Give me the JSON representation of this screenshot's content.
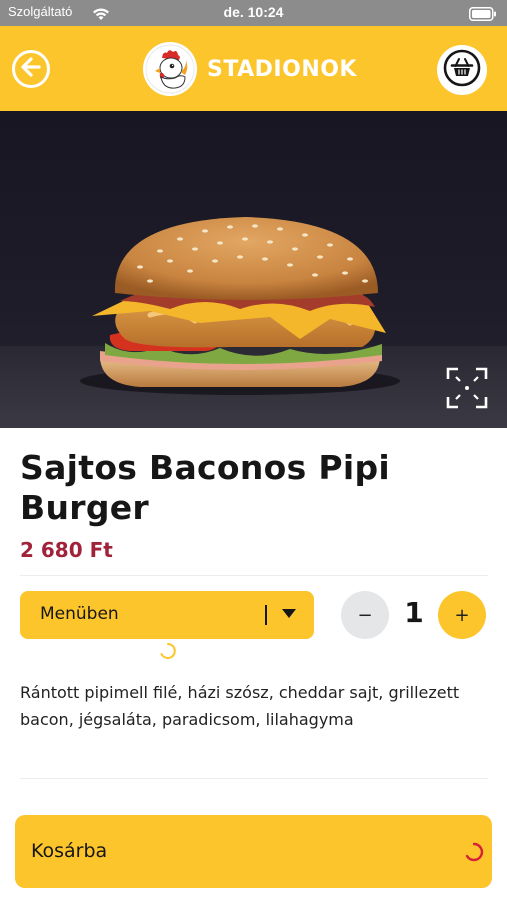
{
  "status_bar": {
    "carrier": "Szolgáltató",
    "time": "de. 10:24",
    "icons": [
      "wifi-icon",
      "battery-icon"
    ]
  },
  "header": {
    "brand_name": "STADIONOK",
    "back_icon": "back-arrow-icon",
    "logo_icon": "rooster-logo",
    "basket_icon": "basket-icon"
  },
  "hero": {
    "image": "burger-photo",
    "expand_icon": "expand-icon"
  },
  "product": {
    "title": "Sajtos Baconos Pipi Burger",
    "price": "2 680 Ft",
    "variant": {
      "selected": "Menüben",
      "separator": "|"
    },
    "quantity": {
      "minus_label": "−",
      "value": "1",
      "plus_label": "+"
    },
    "description": "Rántott pipimell filé, házi szósz, cheddar sajt, grillezett bacon, jégsaláta, paradicsom, lilahagyma"
  },
  "cart": {
    "label": "Kosárba",
    "spinner_icon": "loading-spinner-icon"
  },
  "colors": {
    "accent": "#fcc52b",
    "price": "#a0233a",
    "qty_minus_bg": "#e4e6e8",
    "status_bar": "#8c8c8c"
  }
}
